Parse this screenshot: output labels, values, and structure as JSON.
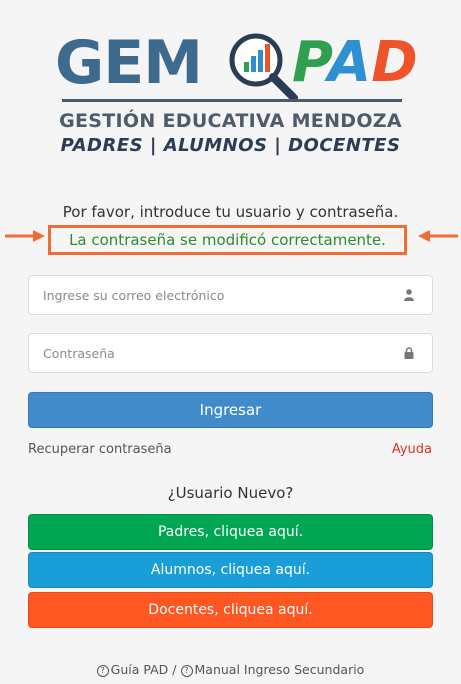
{
  "logo": {
    "gem": "GEM",
    "pad_p": "P",
    "pad_a": "A",
    "pad_d": "D",
    "subtitle": "GESTIÓN EDUCATIVA MENDOZA",
    "roles": "PADRES | ALUMNOS | DOCENTES"
  },
  "login": {
    "prompt": "Por favor, introduce tu usuario y contraseña.",
    "success_message": "La contraseña se modificó correctamente.",
    "email_placeholder": "Ingrese su correo electrónico",
    "password_placeholder": "Contraseña",
    "submit_label": "Ingresar",
    "recover_label": "Recuperar contraseña",
    "help_label": "Ayuda"
  },
  "new_user": {
    "heading": "¿Usuario Nuevo?",
    "padres_label": "Padres, cliquea aquí.",
    "alumnos_label": "Alumnos, cliquea aquí.",
    "docentes_label": "Docentes, cliquea aquí."
  },
  "footer": {
    "guide_label": "Guía PAD",
    "separator": "/",
    "manual_label": "Manual Ingreso Secundario"
  },
  "colors": {
    "brand_blue": "#3d6a8d",
    "login_button": "#428bca",
    "padres": "#00a651",
    "alumnos": "#1a9ed8",
    "docentes": "#ff5722",
    "highlight_border": "#ef6c35",
    "success_text": "#2e8b2e",
    "help_link": "#e03020"
  },
  "icons": {
    "email_field": "user-icon",
    "password_field": "lock-icon",
    "footer_links": "question-circle-icon",
    "annotation": "arrow-icon"
  }
}
